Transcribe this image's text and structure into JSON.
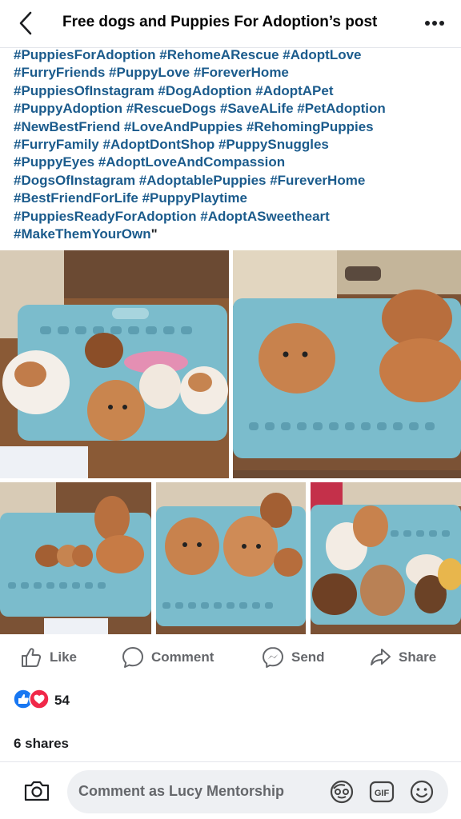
{
  "header": {
    "title": "Free dogs and Puppies For Adoption’s post"
  },
  "post": {
    "hashtag_lines": [
      "#PuppiesForAdoption #RehomeARescue #AdoptLove",
      "#FurryFriends #PuppyLove #ForeverHome",
      "#PuppiesOfInstagram #DogAdoption #AdoptAPet",
      "#PuppyAdoption #RescueDogs #SaveALife #PetAdoption",
      "#NewBestFriend #LoveAndPuppies #RehomingPuppies",
      "#FurryFamily #AdoptDontShop #PuppySnuggles",
      "#PuppyEyes #AdoptLoveAndCompassion",
      "#DogsOfInstagram #AdoptablePuppies #FureverHome",
      "#BestFriendForLife #PuppyPlaytime",
      "#PuppiesReadyForAdoption #AdoptASweetheart",
      "#MakeThemYourOwn"
    ],
    "hashtag_tail": "\"",
    "photos": [
      "puppies-in-laundry-basket-1",
      "puppies-in-laundry-basket-2",
      "puppies-in-laundry-basket-3",
      "puppies-in-laundry-basket-4",
      "puppies-in-laundry-basket-5"
    ]
  },
  "actions": {
    "like": "Like",
    "comment": "Comment",
    "send": "Send",
    "share": "Share"
  },
  "reactions": {
    "count": "54",
    "types": [
      "like",
      "love"
    ]
  },
  "shares": "6 shares",
  "comment_bar": {
    "placeholder": "Comment as Lucy Mentorship",
    "icons": [
      "camera-icon",
      "avatar-sticker-icon",
      "gif-icon",
      "emoji-icon"
    ]
  },
  "colors": {
    "hashtag": "#1b5b8c",
    "like_blue": "#1877f2",
    "love_red": "#f02849",
    "muted": "#65676b",
    "basket": "#7bbccc"
  }
}
